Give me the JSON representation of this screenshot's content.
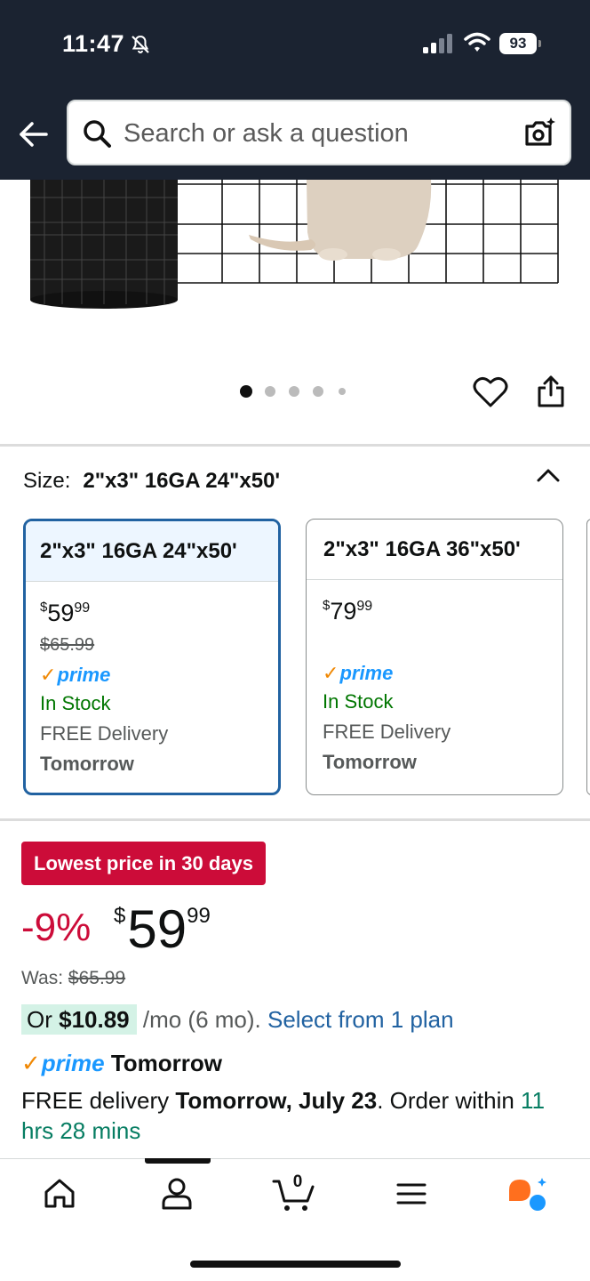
{
  "status_bar": {
    "time": "11:47",
    "battery": "93"
  },
  "search": {
    "placeholder": "Search or ask a question"
  },
  "image_carousel": {
    "dot_count": 5,
    "active_index": 0
  },
  "size_selector": {
    "label": "Size:",
    "selected_value": "2\"x3\" 16GA 24\"x50'",
    "options": [
      {
        "title": "2\"x3\" 16GA 24\"x50'",
        "price_symbol": "$",
        "price_whole": "59",
        "price_cents": "99",
        "list_price": "$65.99",
        "prime_label": "prime",
        "stock": "In Stock",
        "delivery_line": "FREE Delivery",
        "delivery_day": "Tomorrow",
        "selected": true
      },
      {
        "title": "2\"x3\" 16GA 36\"x50'",
        "price_symbol": "$",
        "price_whole": "79",
        "price_cents": "99",
        "list_price": "",
        "prime_label": "prime",
        "stock": "In Stock",
        "delivery_line": "FREE Delivery",
        "delivery_day": "Tomorrow",
        "selected": false
      }
    ]
  },
  "deal": {
    "badge": "Lowest price in 30 days",
    "discount": "-9%",
    "price_symbol": "$",
    "price_whole": "59",
    "price_cents": "99",
    "was_label": "Was:",
    "was_price": "$65.99"
  },
  "installment": {
    "prefix": "Or ",
    "amount": "$10.89",
    "suffix": " /mo (6 mo). ",
    "link": "Select from 1 plan"
  },
  "delivery": {
    "prime_word": "prime",
    "prime_day": "Tomorrow",
    "line_start": "FREE delivery ",
    "date": "Tomorrow, July 23",
    "mid": ". Order within ",
    "countdown": "11 hrs 28 mins"
  },
  "bottom_nav": {
    "cart_count": "0",
    "items": [
      "home",
      "account",
      "cart",
      "menu",
      "rufus"
    ]
  },
  "colors": {
    "header_bg": "#1b2331",
    "deal_red": "#cc0c39",
    "link_blue": "#2162a1",
    "prime_blue": "#1a98ff",
    "in_stock_green": "#007600",
    "selected_border": "#2162a1"
  }
}
